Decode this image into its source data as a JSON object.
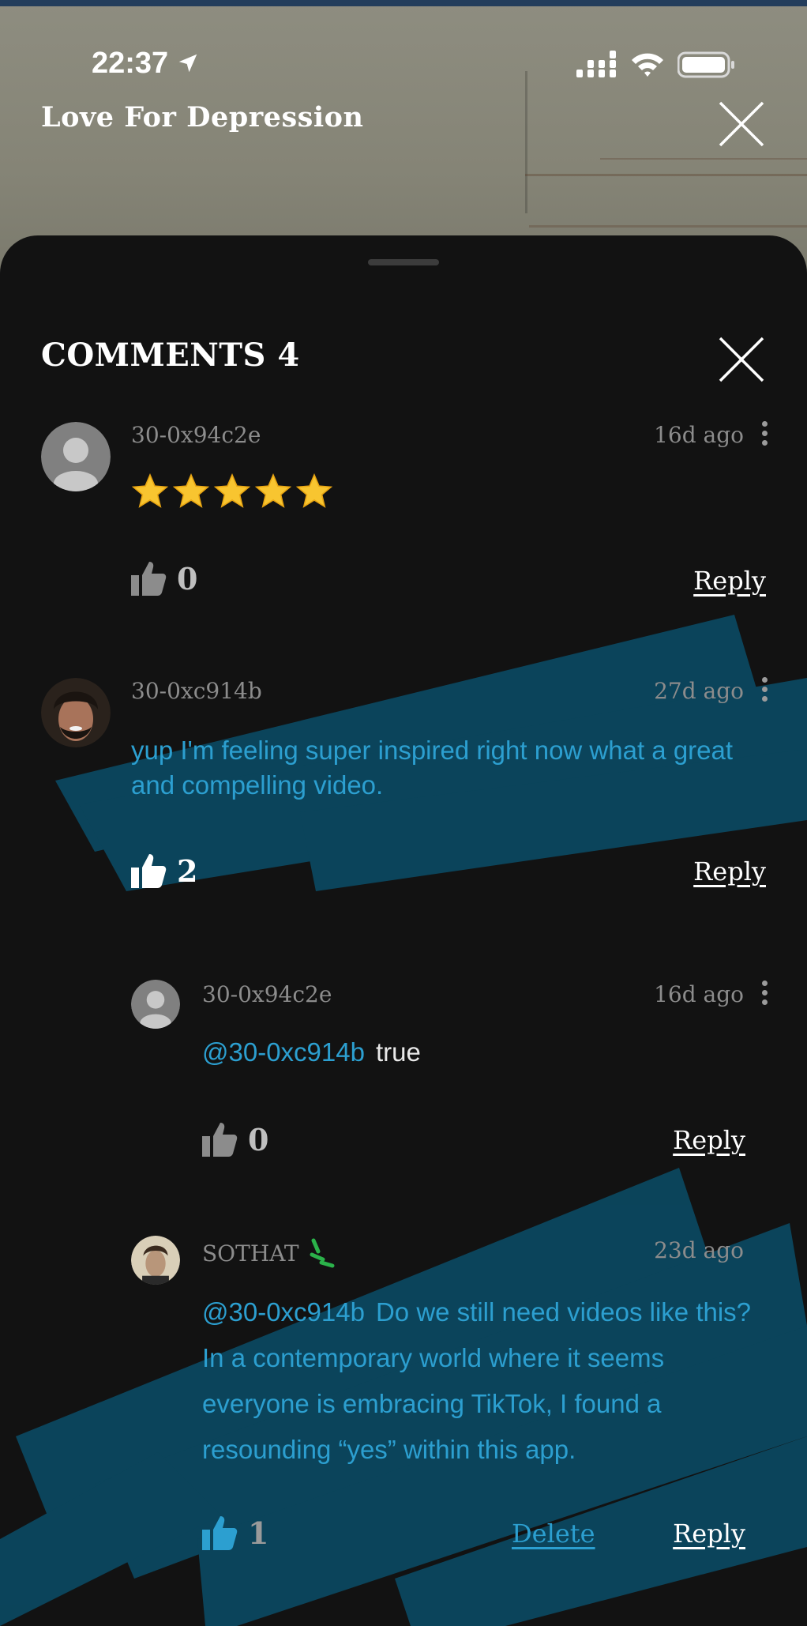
{
  "status_bar": {
    "time": "22:37"
  },
  "video": {
    "title": "Love For Depression"
  },
  "comments_sheet": {
    "title": "COMMENTS 4",
    "reply_label": "Reply",
    "delete_label": "Delete"
  },
  "comments": [
    {
      "username": "30-0x94c2e",
      "time_ago": "16d ago",
      "rating_stars": 5,
      "likes": "0"
    },
    {
      "username": "30-0xc914b",
      "time_ago": "27d ago",
      "text": "yup I'm feeling super inspired right now what a great and compelling video.",
      "likes": "2"
    }
  ],
  "replies": [
    {
      "username": "30-0x94c2e",
      "time_ago": "16d ago",
      "mention": "@30-0xc914b",
      "text": "true",
      "likes": "0"
    },
    {
      "username": "SOTHAT",
      "time_ago": "23d ago",
      "mention": "@30-0xc914b",
      "text": "Do we still need videos like this? In a contemporary world where it seems everyone is embracing TikTok, I found a resounding “yes” within this app.",
      "likes": "1"
    }
  ],
  "colors": {
    "background": "#121212",
    "accent_blue": "#2c9fd0",
    "muted_text": "#8c8c8c",
    "scribble": "#0b4a63"
  }
}
